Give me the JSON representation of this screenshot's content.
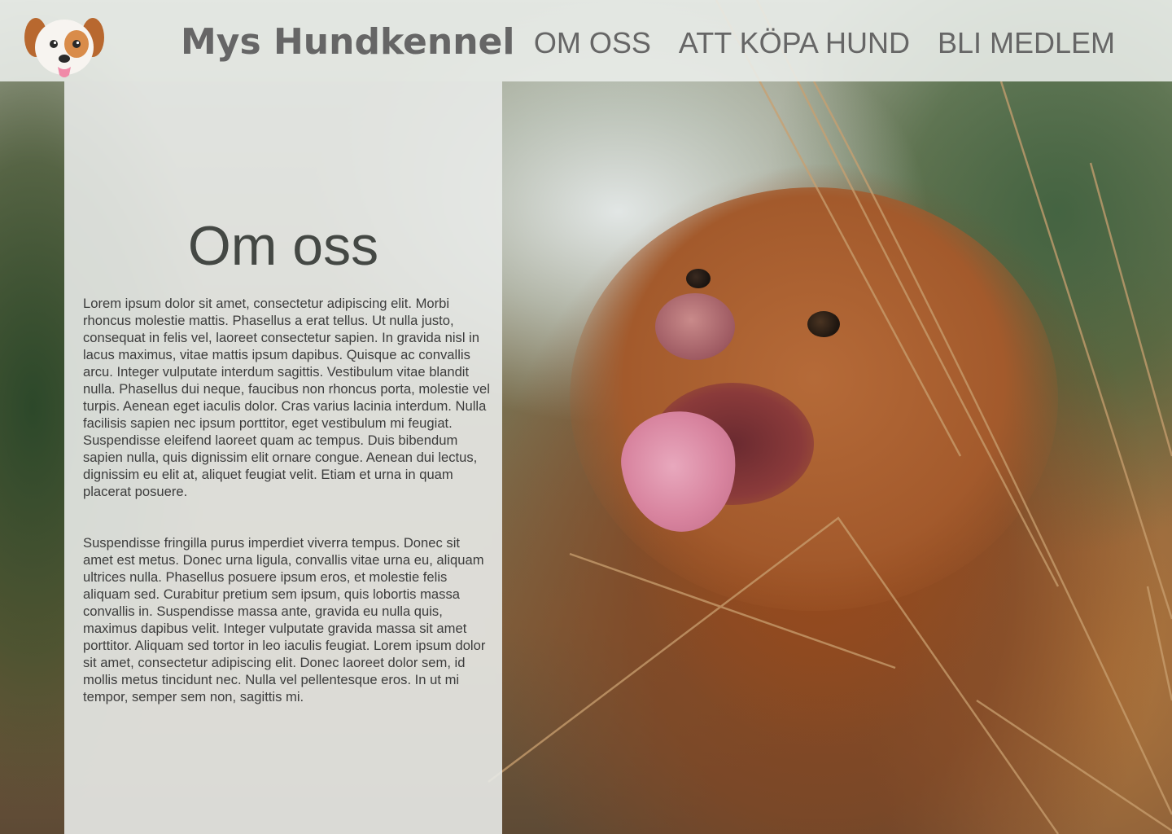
{
  "header": {
    "logo_icon": "dog-face-icon",
    "site_title": "Mys Hundkennel",
    "nav": [
      {
        "label": "OM OSS"
      },
      {
        "label": "ATT KÖPA HUND"
      },
      {
        "label": "BLI MEDLEM"
      }
    ]
  },
  "main": {
    "title": "Om oss",
    "paragraphs": [
      "Lorem ipsum dolor sit amet, consectetur adipiscing elit. Morbi rhoncus molestie mattis. Phasellus a erat tellus. Ut nulla justo, consequat in felis vel, laoreet consectetur sapien. In gravida nisl in lacus maximus, vitae mattis ipsum dapibus. Quisque ac convallis arcu. Integer vulputate interdum sagittis. Vestibulum vitae blandit nulla. Phasellus dui neque, faucibus non rhoncus porta, molestie vel turpis. Aenean eget iaculis dolor. Cras varius lacinia interdum. Nulla facilisis sapien nec ipsum porttitor, eget vestibulum mi feugiat. Suspendisse eleifend laoreet quam ac tempus. Duis bibendum sapien nulla, quis dignissim elit ornare congue. Aenean dui lectus, dignissim eu elit at, aliquet feugiat velit. Etiam et urna in quam placerat posuere.",
      "Suspendisse fringilla purus imperdiet viverra tempus. Donec sit amet est metus. Donec urna ligula, convallis vitae urna eu, aliquam ultrices nulla. Phasellus posuere ipsum eros, et molestie felis aliquam sed. Curabitur pretium sem ipsum, quis lobortis massa convallis in. Suspendisse massa ante, gravida eu nulla quis, maximus dapibus velit. Integer vulputate gravida massa sit amet porttitor. Aliquam sed tortor in leo iaculis feugiat. Lorem ipsum dolor sit amet, consectetur adipiscing elit. Donec laoreet dolor sem, id mollis metus tincidunt nec. Nulla vel pellentesque eros. In ut mi tempor, semper sem non, sagittis mi."
    ]
  },
  "background": {
    "image_subject": "brown-dog-in-tall-grass-photo"
  },
  "colors": {
    "header_bg": "#ebeeeb",
    "nav_text": "#666666",
    "panel_bg": "#e8eae8",
    "body_text": "#3c3c3c"
  }
}
